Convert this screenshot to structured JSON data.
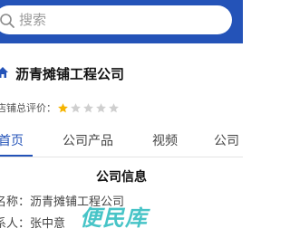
{
  "search": {
    "placeholder": "搜索"
  },
  "company": {
    "name": "沥青摊铺工程公司"
  },
  "rating": {
    "label": "店铺总评价：",
    "stars_filled": 1,
    "stars_total": 5
  },
  "tabs": [
    {
      "label": "首页",
      "active": true
    },
    {
      "label": "公司产品",
      "active": false
    },
    {
      "label": "视频",
      "active": false
    },
    {
      "label": "公司",
      "active": false
    }
  ],
  "info": {
    "title": "公司信息",
    "name_line": "名称：沥青摊铺工程公司",
    "contact_line": "系人：张中意"
  },
  "watermark": {
    "text": "便民库"
  },
  "colors": {
    "header": "#2453b8",
    "accent": "#2453b8",
    "star_filled": "#f5b400",
    "star_empty": "#cfcfcf"
  }
}
